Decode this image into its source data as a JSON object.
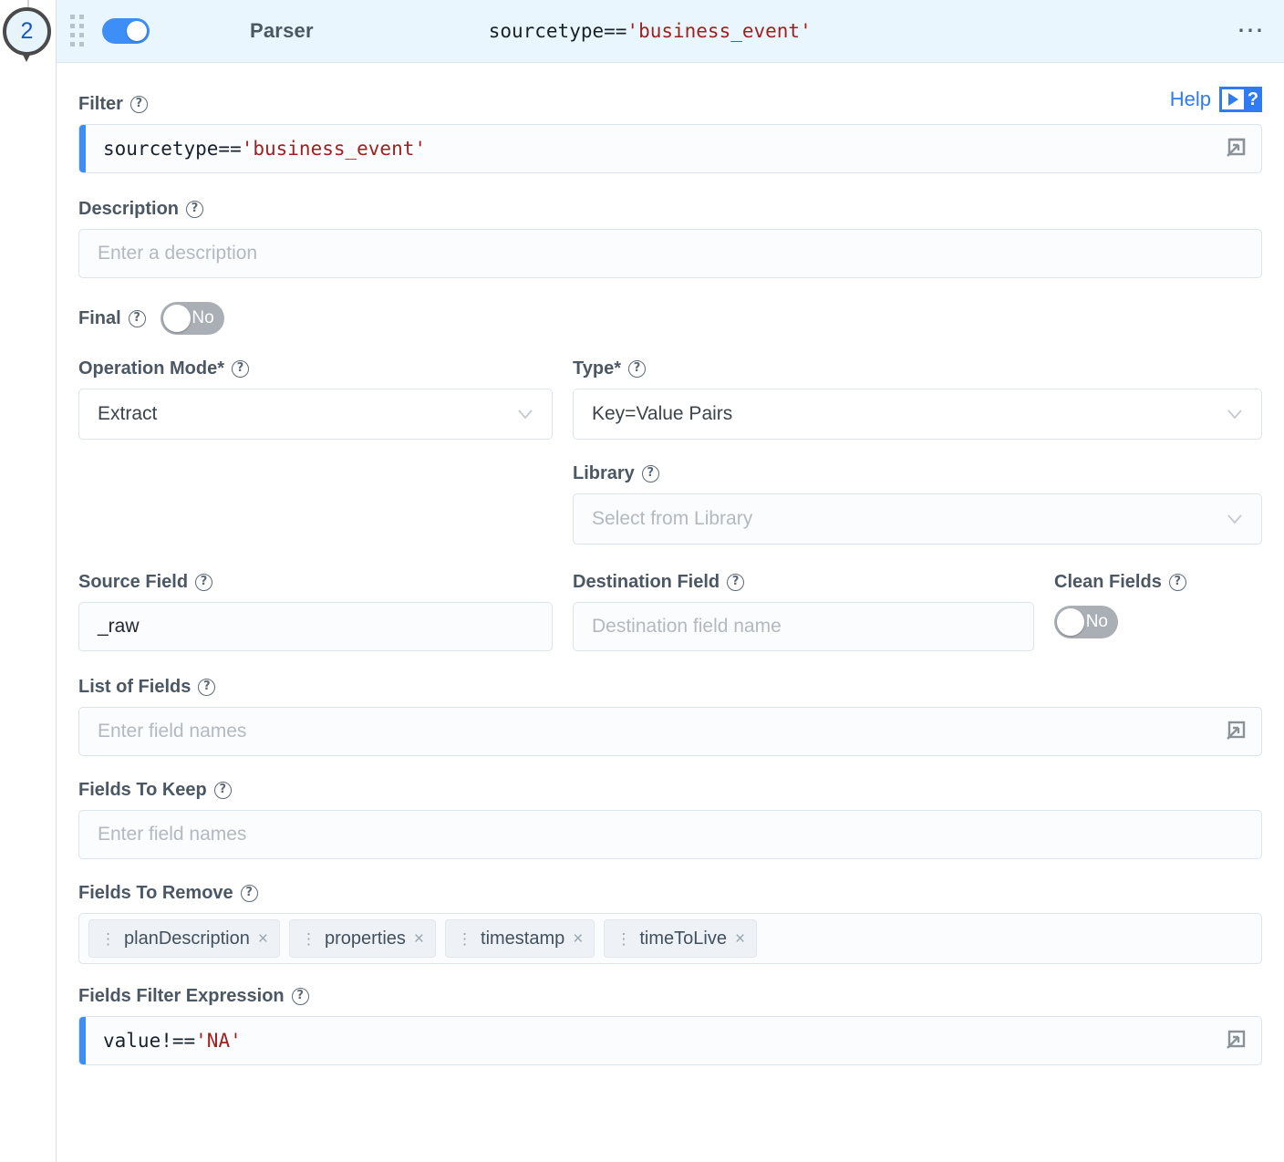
{
  "pin": {
    "number": "2"
  },
  "header": {
    "enabled_toggle": "on",
    "title": "Parser",
    "expression_code": "sourcetype==",
    "expression_string": "'business_event'",
    "menu": "•••"
  },
  "help": {
    "label": "Help",
    "badge_question": "?"
  },
  "fields": {
    "filter": {
      "label": "Filter",
      "code": "sourcetype==",
      "string": "'business_event'"
    },
    "description": {
      "label": "Description",
      "value": "",
      "placeholder": "Enter a description"
    },
    "final": {
      "label": "Final",
      "value": "No"
    },
    "operation_mode": {
      "label": "Operation Mode*",
      "value": "Extract"
    },
    "type": {
      "label": "Type*",
      "value": "Key=Value Pairs"
    },
    "library": {
      "label": "Library",
      "value": "",
      "placeholder": "Select from Library"
    },
    "source_field": {
      "label": "Source Field",
      "value": "_raw"
    },
    "destination_field": {
      "label": "Destination Field",
      "value": "",
      "placeholder": "Destination field name"
    },
    "clean_fields": {
      "label": "Clean Fields",
      "value": "No"
    },
    "list_of_fields": {
      "label": "List of Fields",
      "value": "",
      "placeholder": "Enter field names"
    },
    "fields_to_keep": {
      "label": "Fields To Keep",
      "value": "",
      "placeholder": "Enter field names"
    },
    "fields_to_remove": {
      "label": "Fields To Remove",
      "chips": [
        {
          "label": "planDescription"
        },
        {
          "label": "properties"
        },
        {
          "label": "timestamp"
        },
        {
          "label": "timeToLive"
        }
      ]
    },
    "fields_filter_expression": {
      "label": "Fields Filter Expression",
      "code": "value!==",
      "string": "'NA'"
    }
  },
  "icons": {
    "help_tooltip": "?",
    "chip_grip": "⋮",
    "chip_remove": "×"
  },
  "colors": {
    "accent_blue": "#3d8ef7",
    "header_bg": "#eaf6fd",
    "string_red": "#a02020",
    "label_gray": "#4b5763"
  }
}
